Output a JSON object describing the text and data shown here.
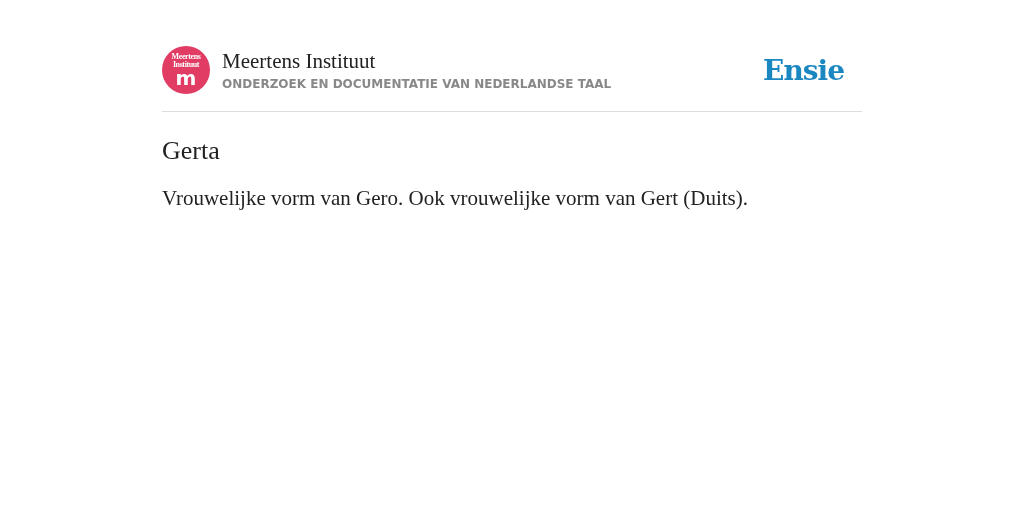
{
  "header": {
    "logo": {
      "line_1": "Meertens",
      "line_2": "Instituut",
      "letter": "m"
    },
    "title": "Meertens Instituut",
    "subtitle": "ONDERZOEK EN DOCUMENTATIE VAN NEDERLANDSE TAAL",
    "brand": "Ensie"
  },
  "entry": {
    "title": "Gerta",
    "description": "Vrouwelijke vorm van Gero. Ook vrouwelijke vorm van Gert (Duits)."
  }
}
